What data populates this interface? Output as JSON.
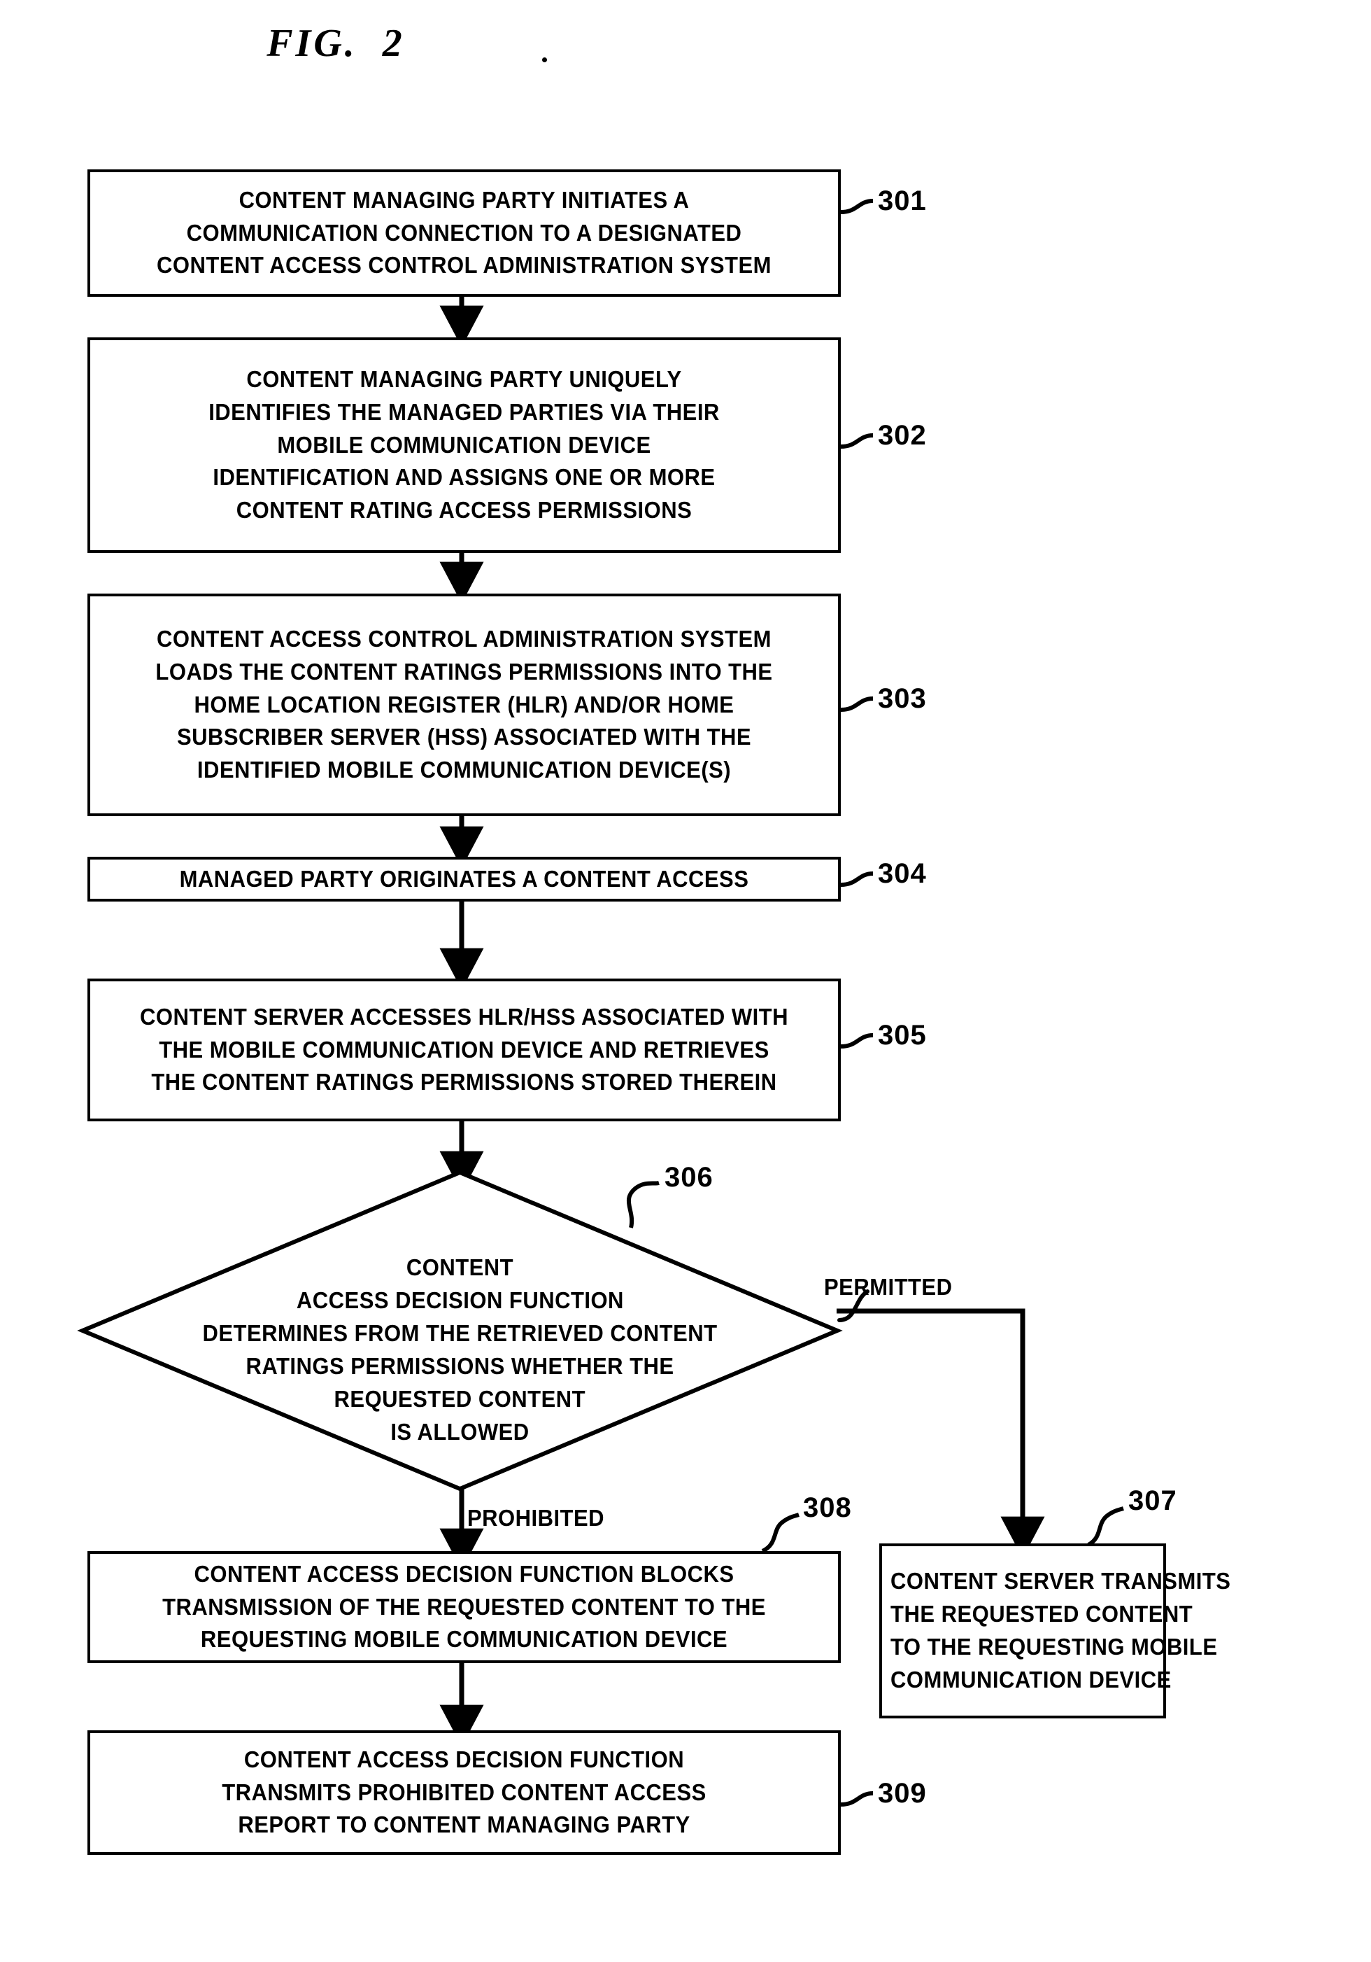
{
  "figure": {
    "title": "FIG.  2",
    "type": "patent-flowchart"
  },
  "nodes": [
    {
      "ref": "301",
      "shape": "process",
      "lines": [
        "CONTENT MANAGING PARTY INITIATES A",
        "COMMUNICATION CONNECTION TO A DESIGNATED",
        "CONTENT ACCESS CONTROL ADMINISTRATION SYSTEM"
      ]
    },
    {
      "ref": "302",
      "shape": "process",
      "lines": [
        "CONTENT MANAGING PARTY UNIQUELY",
        "IDENTIFIES THE MANAGED PARTIES VIA THEIR",
        "MOBILE COMMUNICATION DEVICE",
        "IDENTIFICATION AND ASSIGNS ONE OR MORE",
        "CONTENT RATING ACCESS PERMISSIONS"
      ]
    },
    {
      "ref": "303",
      "shape": "process",
      "lines": [
        "CONTENT ACCESS CONTROL ADMINISTRATION SYSTEM",
        "LOADS THE CONTENT RATINGS PERMISSIONS INTO THE",
        "HOME LOCATION REGISTER (HLR) AND/OR HOME",
        "SUBSCRIBER SERVER (HSS) ASSOCIATED WITH THE",
        "IDENTIFIED MOBILE COMMUNICATION DEVICE(S)"
      ]
    },
    {
      "ref": "304",
      "shape": "process",
      "lines": [
        "MANAGED PARTY ORIGINATES A CONTENT ACCESS"
      ]
    },
    {
      "ref": "305",
      "shape": "process",
      "lines": [
        "CONTENT SERVER ACCESSES HLR/HSS ASSOCIATED WITH",
        "THE MOBILE COMMUNICATION DEVICE AND RETRIEVES",
        "THE CONTENT RATINGS PERMISSIONS STORED THEREIN"
      ]
    },
    {
      "ref": "306",
      "shape": "decision",
      "lines": [
        "CONTENT",
        "ACCESS DECISION FUNCTION",
        "DETERMINES FROM THE RETRIEVED CONTENT",
        "RATINGS PERMISSIONS WHETHER THE",
        "REQUESTED CONTENT",
        "IS ALLOWED"
      ]
    },
    {
      "ref": "307",
      "shape": "process",
      "lines": [
        "CONTENT SERVER TRANSMITS",
        "THE REQUESTED CONTENT",
        "TO THE REQUESTING MOBILE",
        "COMMUNICATION DEVICE"
      ]
    },
    {
      "ref": "308",
      "shape": "process",
      "lines": [
        "CONTENT ACCESS DECISION FUNCTION BLOCKS",
        "TRANSMISSION OF THE REQUESTED CONTENT TO THE",
        "REQUESTING MOBILE COMMUNICATION DEVICE"
      ]
    },
    {
      "ref": "309",
      "shape": "process",
      "lines": [
        "CONTENT ACCESS DECISION FUNCTION",
        "TRANSMITS PROHIBITED CONTENT ACCESS",
        "REPORT TO CONTENT MANAGING PARTY"
      ]
    }
  ],
  "branch_labels": {
    "permitted": "PERMITTED",
    "prohibited": "PROHIBITED"
  },
  "colors": {
    "ink": "#000000",
    "paper": "#ffffff"
  }
}
